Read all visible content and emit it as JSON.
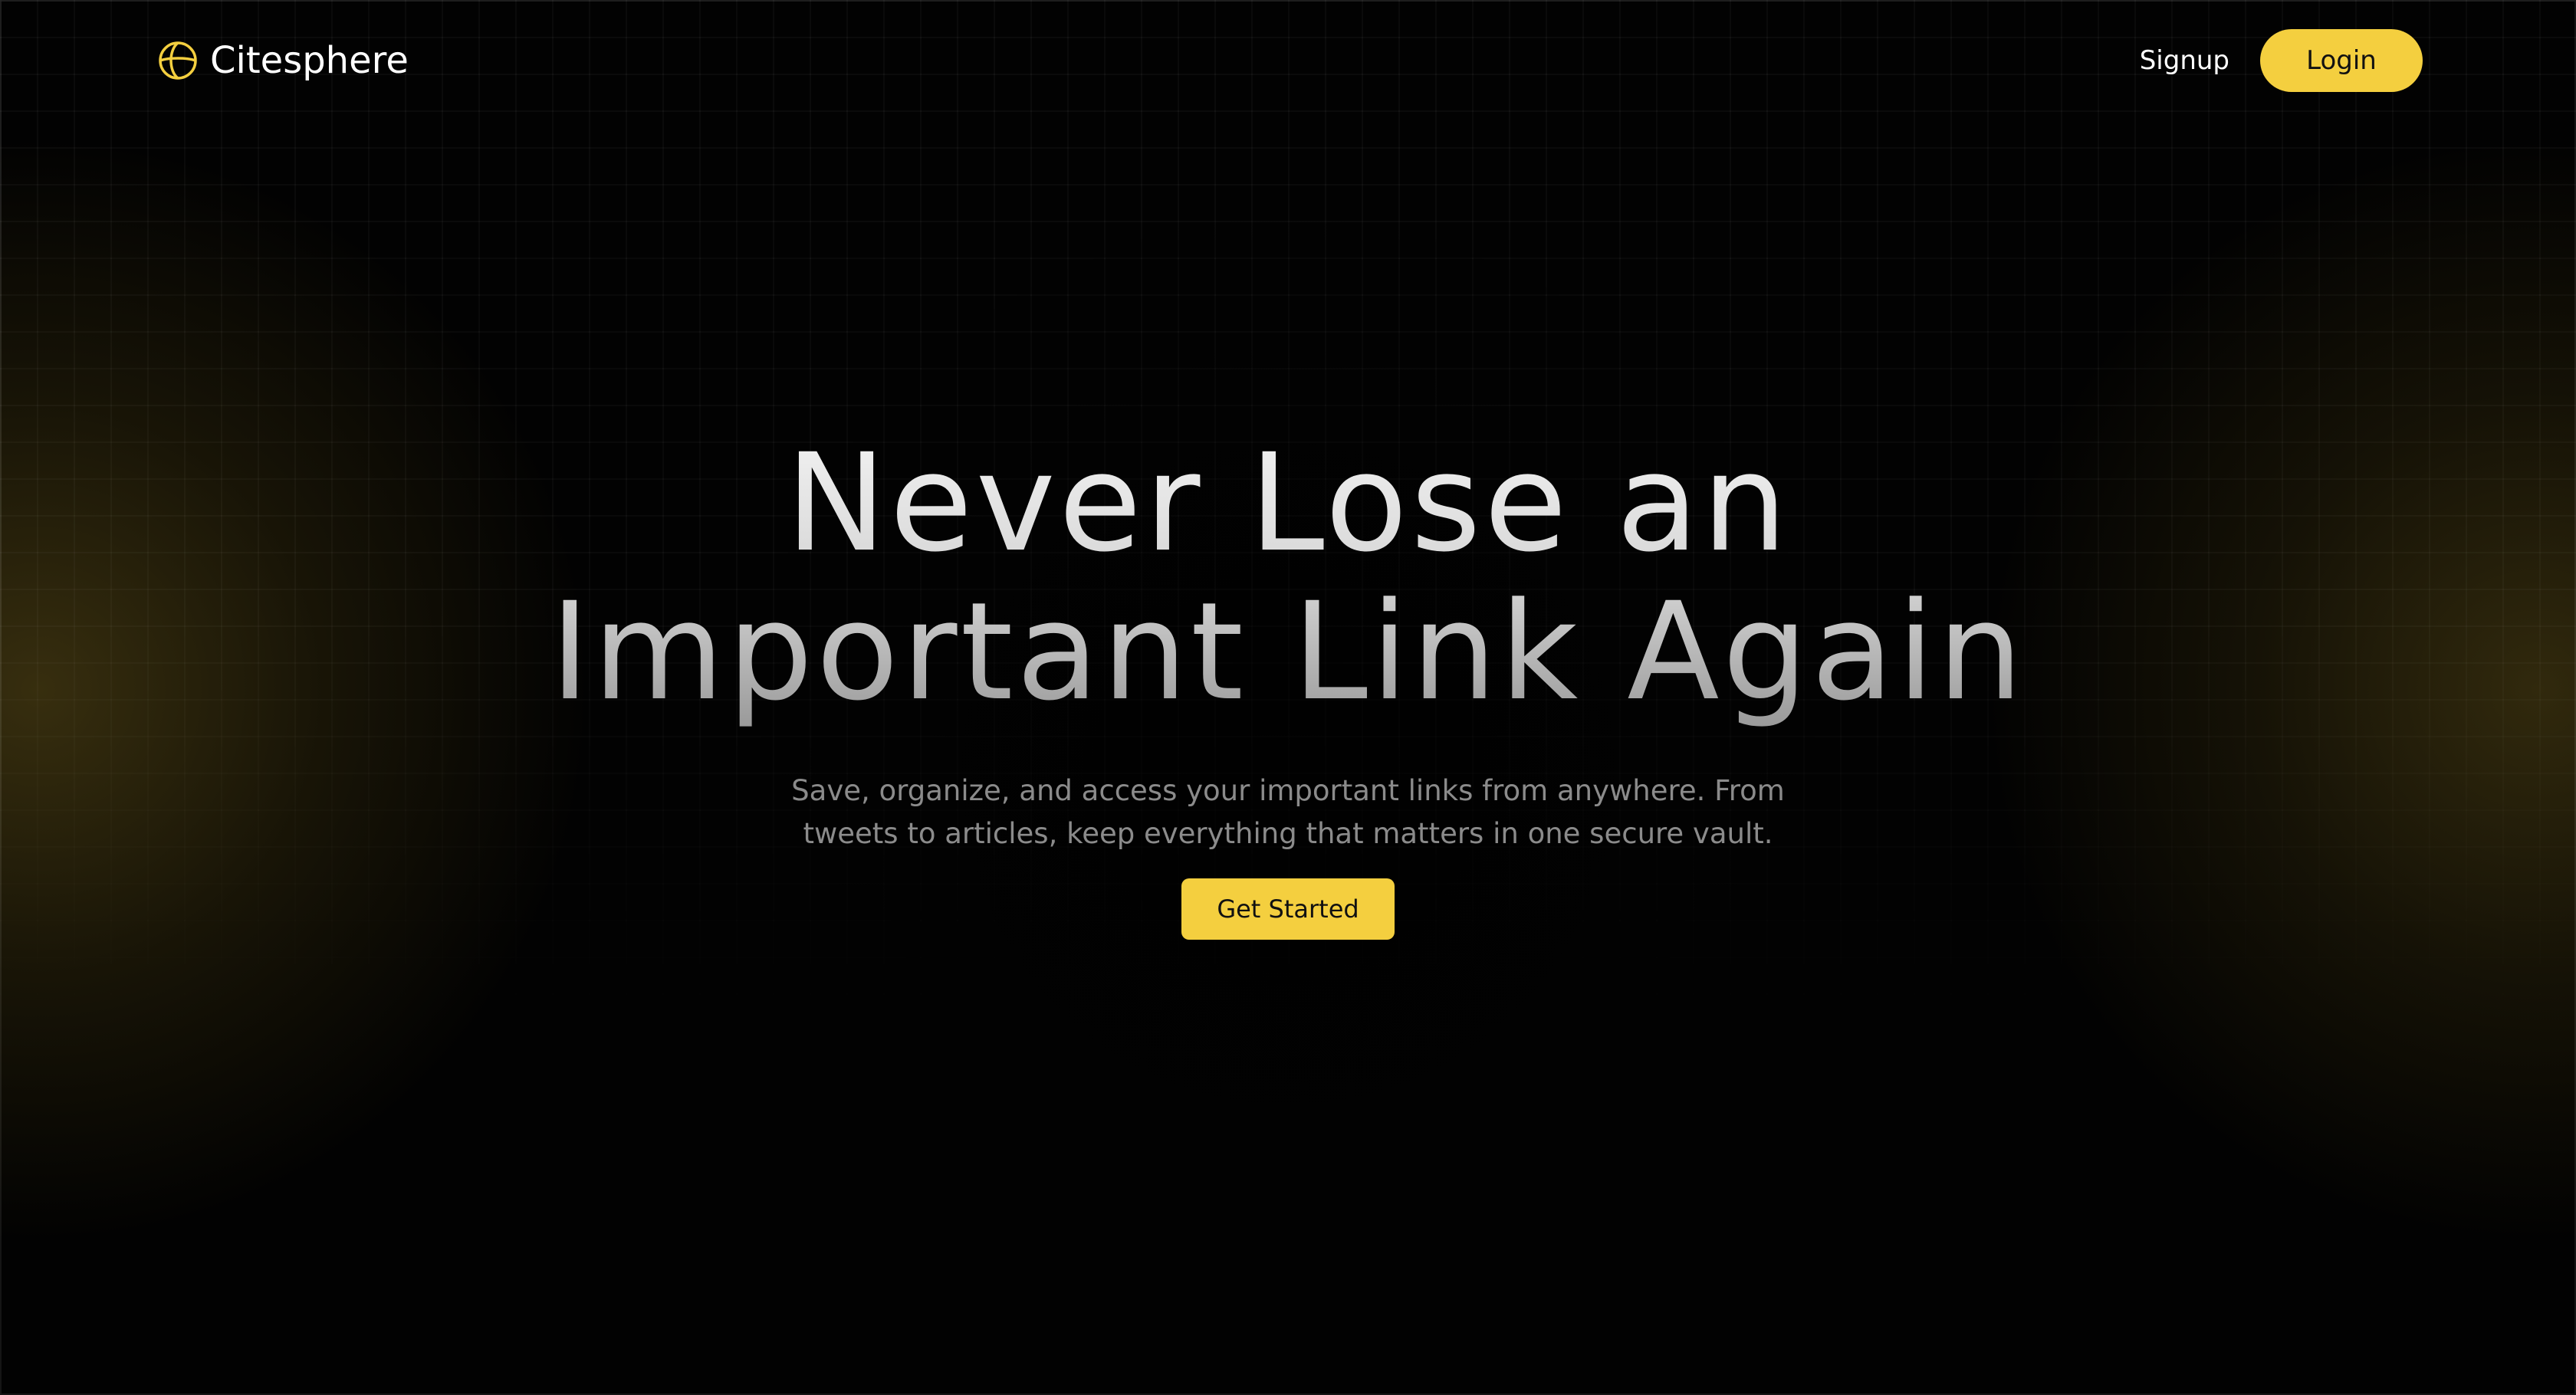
{
  "brand": {
    "name": "Citesphere",
    "icon": "globe-icon",
    "accent_color": "#F4CF3F"
  },
  "nav": {
    "signup_label": "Signup",
    "login_label": "Login"
  },
  "hero": {
    "title_line_1": "Never Lose an",
    "title_line_2": "Important Link Again",
    "subtitle": "Save, organize, and access your important links from anywhere. From tweets to articles, keep everything that matters in one secure vault.",
    "cta_label": "Get Started"
  },
  "colors": {
    "background": "#000000",
    "accent": "#F4CF3F",
    "subtitle_text": "#8B8B8B"
  }
}
